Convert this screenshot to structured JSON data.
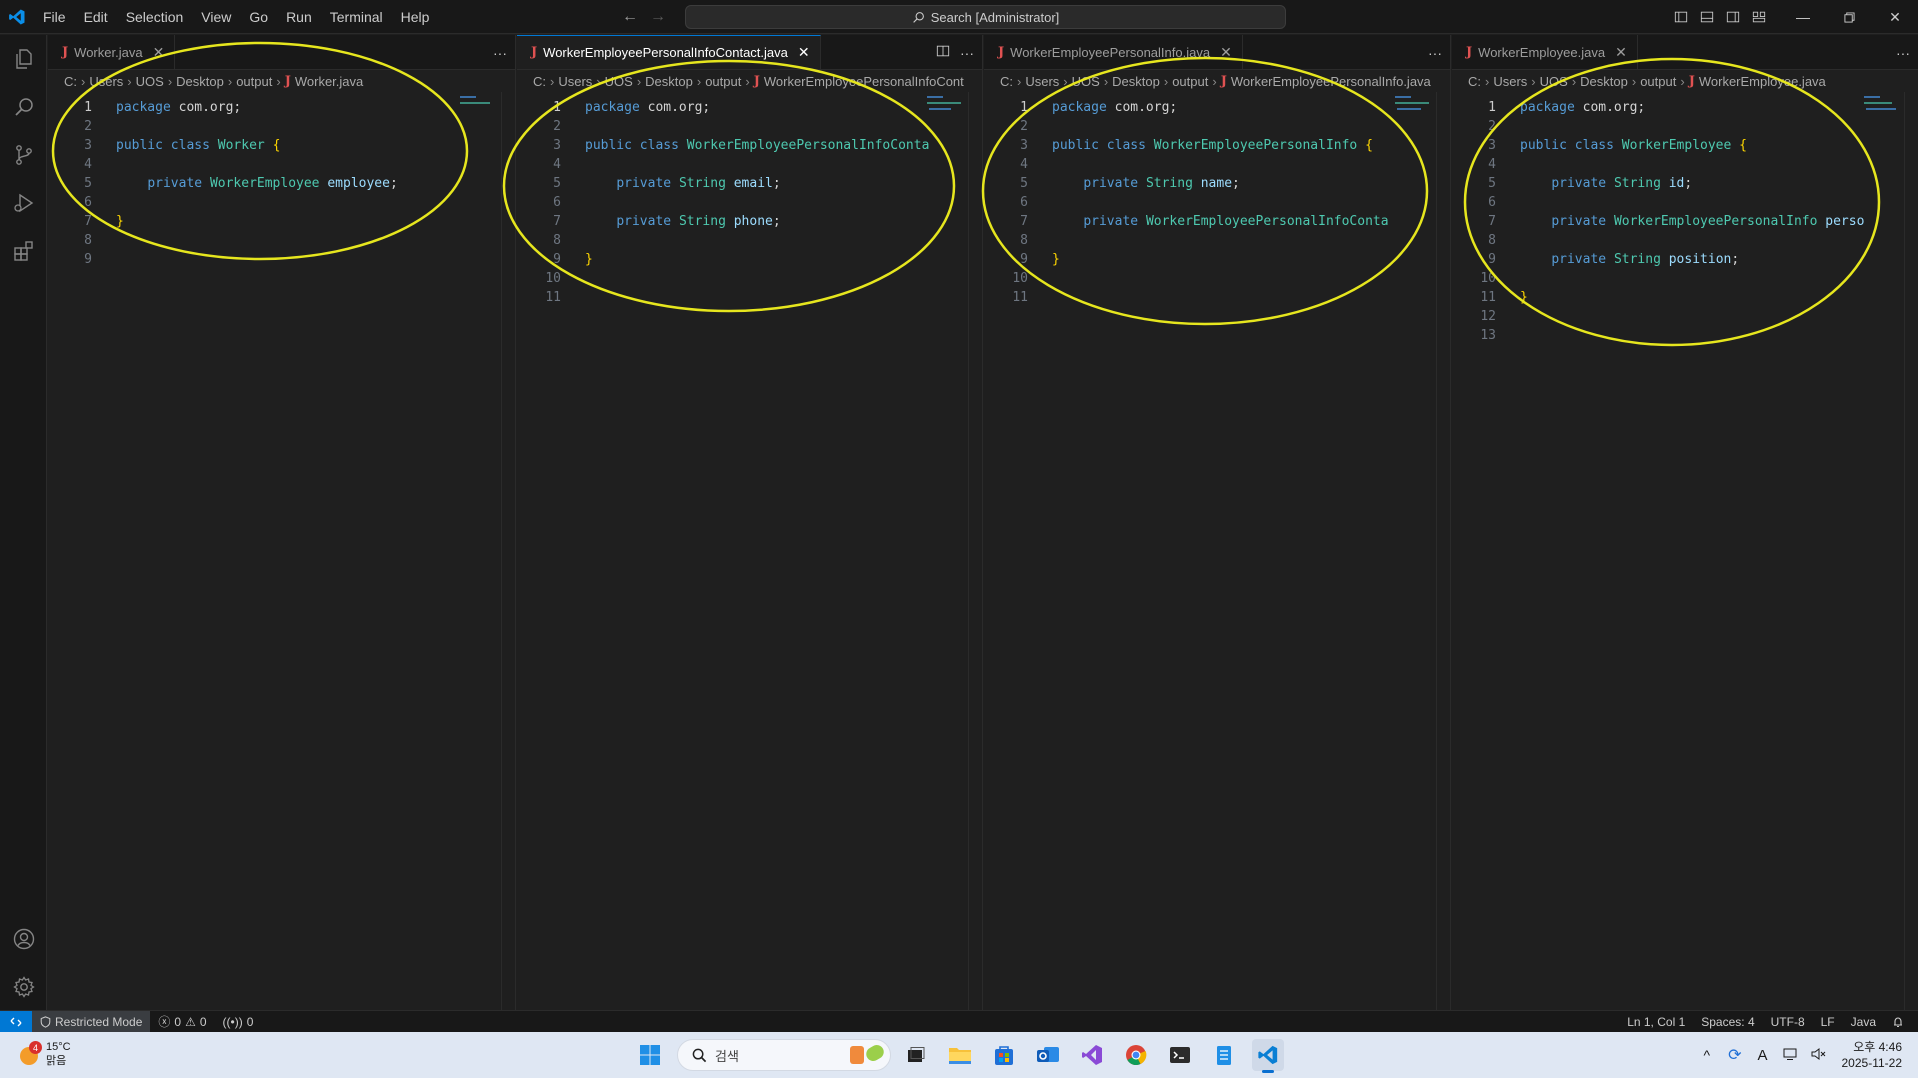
{
  "menu": [
    "File",
    "Edit",
    "Selection",
    "View",
    "Go",
    "Run",
    "Terminal",
    "Help"
  ],
  "search": {
    "label": "Search [Administrator]"
  },
  "panes": [
    {
      "tab": "Worker.java",
      "active": false,
      "crumbs": [
        "C:",
        "Users",
        "UOS",
        "Desktop",
        "output"
      ],
      "crumb_file": "Worker.java",
      "lines": [
        [
          [
            "kw",
            "package"
          ],
          [
            "pl",
            " com.org;"
          ]
        ],
        [],
        [
          [
            "kw",
            "public"
          ],
          [
            "pl",
            " "
          ],
          [
            "kw",
            "class"
          ],
          [
            "pl",
            " "
          ],
          [
            "ty",
            "Worker"
          ],
          [
            "pl",
            " "
          ],
          [
            "br",
            "{"
          ]
        ],
        [],
        [
          [
            "pl",
            "    "
          ],
          [
            "kw",
            "private"
          ],
          [
            "pl",
            " "
          ],
          [
            "ty",
            "WorkerEmployee"
          ],
          [
            "pl",
            " "
          ],
          [
            "id",
            "employee"
          ],
          [
            "pl",
            ";"
          ]
        ],
        [],
        [
          [
            "br",
            "}"
          ]
        ],
        [],
        []
      ]
    },
    {
      "tab": "WorkerEmployeePersonalInfoContact.java",
      "active": true,
      "crumbs": [
        "C:",
        "Users",
        "UOS",
        "Desktop",
        "output"
      ],
      "crumb_file": "WorkerEmployeePersonalInfoCont",
      "lines": [
        [
          [
            "kw",
            "package"
          ],
          [
            "pl",
            " com.org;"
          ]
        ],
        [],
        [
          [
            "kw",
            "public"
          ],
          [
            "pl",
            " "
          ],
          [
            "kw",
            "class"
          ],
          [
            "pl",
            " "
          ],
          [
            "ty",
            "WorkerEmployeePersonalInfoConta"
          ]
        ],
        [],
        [
          [
            "pl",
            "    "
          ],
          [
            "kw",
            "private"
          ],
          [
            "pl",
            " "
          ],
          [
            "ty",
            "String"
          ],
          [
            "pl",
            " "
          ],
          [
            "id",
            "email"
          ],
          [
            "pl",
            ";"
          ]
        ],
        [],
        [
          [
            "pl",
            "    "
          ],
          [
            "kw",
            "private"
          ],
          [
            "pl",
            " "
          ],
          [
            "ty",
            "String"
          ],
          [
            "pl",
            " "
          ],
          [
            "id",
            "phone"
          ],
          [
            "pl",
            ";"
          ]
        ],
        [],
        [
          [
            "br",
            "}"
          ]
        ],
        [],
        []
      ]
    },
    {
      "tab": "WorkerEmployeePersonalInfo.java",
      "active": false,
      "crumbs": [
        "C:",
        "Users",
        "UOS",
        "Desktop",
        "output"
      ],
      "crumb_file": "WorkerEmployeePersonalInfo.java",
      "lines": [
        [
          [
            "kw",
            "package"
          ],
          [
            "pl",
            " com.org;"
          ]
        ],
        [],
        [
          [
            "kw",
            "public"
          ],
          [
            "pl",
            " "
          ],
          [
            "kw",
            "class"
          ],
          [
            "pl",
            " "
          ],
          [
            "ty",
            "WorkerEmployeePersonalInfo"
          ],
          [
            "pl",
            " "
          ],
          [
            "br",
            "{"
          ]
        ],
        [],
        [
          [
            "pl",
            "    "
          ],
          [
            "kw",
            "private"
          ],
          [
            "pl",
            " "
          ],
          [
            "ty",
            "String"
          ],
          [
            "pl",
            " "
          ],
          [
            "id",
            "name"
          ],
          [
            "pl",
            ";"
          ]
        ],
        [],
        [
          [
            "pl",
            "    "
          ],
          [
            "kw",
            "private"
          ],
          [
            "pl",
            " "
          ],
          [
            "ty",
            "WorkerEmployeePersonalInfoConta"
          ]
        ],
        [],
        [
          [
            "br",
            "}"
          ]
        ],
        [],
        []
      ]
    },
    {
      "tab": "WorkerEmployee.java",
      "active": false,
      "crumbs": [
        "C:",
        "Users",
        "UOS",
        "Desktop",
        "output"
      ],
      "crumb_file": "WorkerEmployee.java",
      "lines": [
        [
          [
            "kw",
            "package"
          ],
          [
            "pl",
            " com.org;"
          ]
        ],
        [],
        [
          [
            "kw",
            "public"
          ],
          [
            "pl",
            " "
          ],
          [
            "kw",
            "class"
          ],
          [
            "pl",
            " "
          ],
          [
            "ty",
            "WorkerEmployee"
          ],
          [
            "pl",
            " "
          ],
          [
            "br",
            "{"
          ]
        ],
        [],
        [
          [
            "pl",
            "    "
          ],
          [
            "kw",
            "private"
          ],
          [
            "pl",
            " "
          ],
          [
            "ty",
            "String"
          ],
          [
            "pl",
            " "
          ],
          [
            "id",
            "id"
          ],
          [
            "pl",
            ";"
          ]
        ],
        [],
        [
          [
            "pl",
            "    "
          ],
          [
            "kw",
            "private"
          ],
          [
            "pl",
            " "
          ],
          [
            "ty",
            "WorkerEmployeePersonalInfo"
          ],
          [
            "pl",
            " "
          ],
          [
            "id",
            "perso"
          ]
        ],
        [],
        [
          [
            "pl",
            "    "
          ],
          [
            "kw",
            "private"
          ],
          [
            "pl",
            " "
          ],
          [
            "ty",
            "String"
          ],
          [
            "pl",
            " "
          ],
          [
            "id",
            "position"
          ],
          [
            "pl",
            ";"
          ]
        ],
        [],
        [
          [
            "br",
            "}"
          ]
        ],
        [],
        []
      ]
    }
  ],
  "status": {
    "restricted": "Restricted Mode",
    "errors": "0",
    "warnings": "0",
    "ports": "0",
    "position": "Ln 1, Col 1",
    "spaces": "Spaces: 4",
    "encoding": "UTF-8",
    "eol": "LF",
    "language": "Java"
  },
  "taskbar": {
    "weather_badge": "4",
    "temp": "15°C",
    "condition": "맑음",
    "search_placeholder": "검색",
    "time": "오후 4:46",
    "date": "2025-11-22"
  },
  "colors": {
    "accent": "#0078d4",
    "annotation": "#e6e61e",
    "keyword": "#569cd6",
    "type": "#4ec9b0",
    "identifier": "#9cdcfe",
    "java_icon": "#e05252"
  }
}
